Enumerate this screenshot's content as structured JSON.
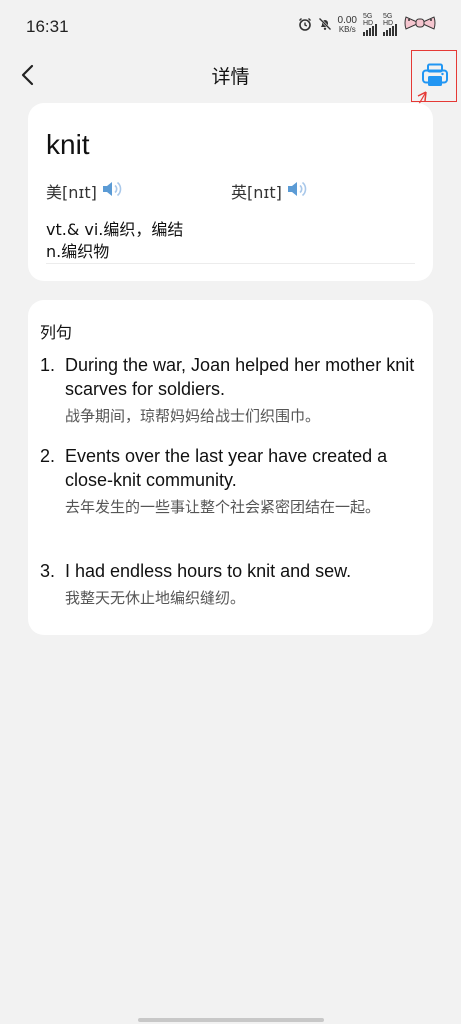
{
  "status_bar": {
    "time": "16:31",
    "net_speed_value": "0.00",
    "net_speed_unit": "KB/s",
    "sim1_label": "5G HD",
    "sim2_label": "5G HD"
  },
  "nav": {
    "title": "详情"
  },
  "word": {
    "headword": "knit",
    "us_phonetic": "美[nɪt]",
    "uk_phonetic": "英[nɪt]",
    "definitions": [
      "vt.& vi.编织，编结",
      "n.编织物"
    ]
  },
  "examples": {
    "title": "列句",
    "items": [
      {
        "num": "1.",
        "en": "During the war, Joan helped her mother knit scarves for soldiers.",
        "cn": "战争期间，琼帮妈妈给战士们织围巾。"
      },
      {
        "num": "2.",
        "en": "Events over the last year have created a close-knit community.",
        "cn": "去年发生的一些事让整个社会紧密团结在一起。"
      },
      {
        "num": "3.",
        "en": "I had endless hours to knit and sew.",
        "cn": "我整天无休止地编织缝纫。"
      }
    ]
  },
  "colors": {
    "accent": "#2196f3",
    "highlight_box": "#e53935",
    "speaker": "#5b9bd5"
  }
}
